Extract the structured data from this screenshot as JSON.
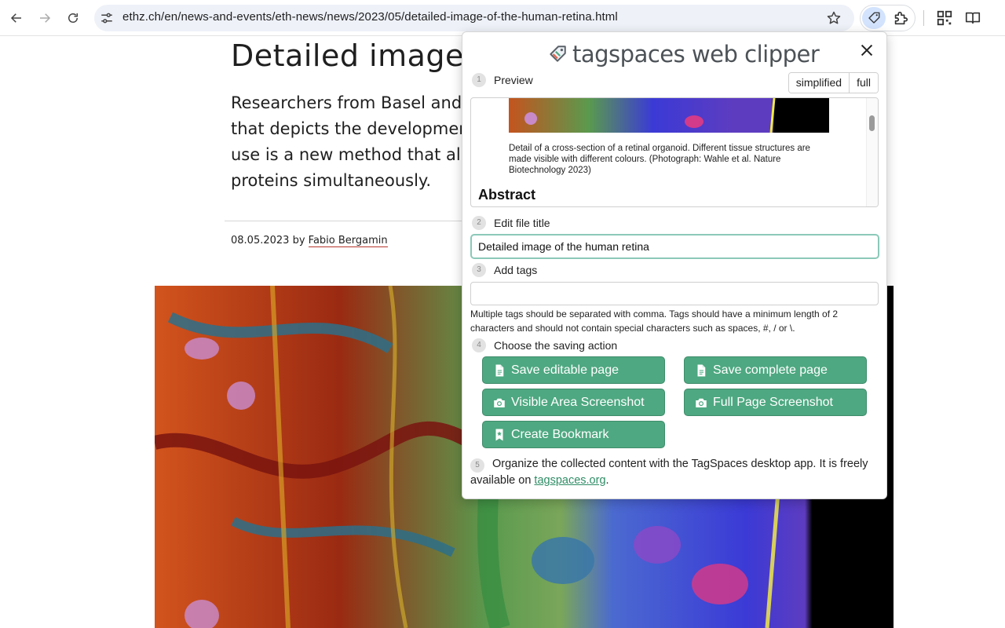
{
  "browser": {
    "url": "ethz.ch/en/news-and-events/eth-news/news/2023/05/detailed-image-of-the-human-retina.html"
  },
  "article": {
    "title": "Detailed image of",
    "lead_lines": [
      "Researchers from Basel and",
      "that depicts the developmen",
      "use is a new method that allo",
      "proteins simultaneously."
    ],
    "date": "08.05.2023",
    "by": "by",
    "author": "Fabio Bergamin"
  },
  "clipper": {
    "logo_text": "tagspaces web clipper",
    "steps": {
      "preview": {
        "num": "1",
        "label": "Preview"
      },
      "title": {
        "num": "2",
        "label": "Edit file title"
      },
      "tags": {
        "num": "3",
        "label": "Add tags"
      },
      "action": {
        "num": "4",
        "label": "Choose the saving action"
      },
      "organize": {
        "num": "5"
      }
    },
    "mode_simplified": "simplified",
    "mode_full": "full",
    "preview_caption": "Detail of a cross-section of a retinal organoid. Different tissue structures are made visible with different colours. (Photograph: Wahle et al. Nature Biotechnology 2023)",
    "preview_heading": "Abstract",
    "file_title": "Detailed image of the human retina",
    "tags_hint": "Multiple tags should be separated with comma. Tags should have a minimum length of 2 characters and should not contain special characters such as spaces, #, / or \\.",
    "actions": {
      "save_editable": "Save editable page",
      "save_complete": "Save complete page",
      "visible_screenshot": "Visible Area Screenshot",
      "full_screenshot": "Full Page Screenshot",
      "bookmark": "Create Bookmark"
    },
    "organize_text": "Organize the collected content with the TagSpaces desktop app. It is freely available on ",
    "organize_link": "tagspaces.org",
    "organize_end": "."
  },
  "colors": {
    "accent_green": "#4ea881",
    "focus_border": "#8cc9b8"
  }
}
